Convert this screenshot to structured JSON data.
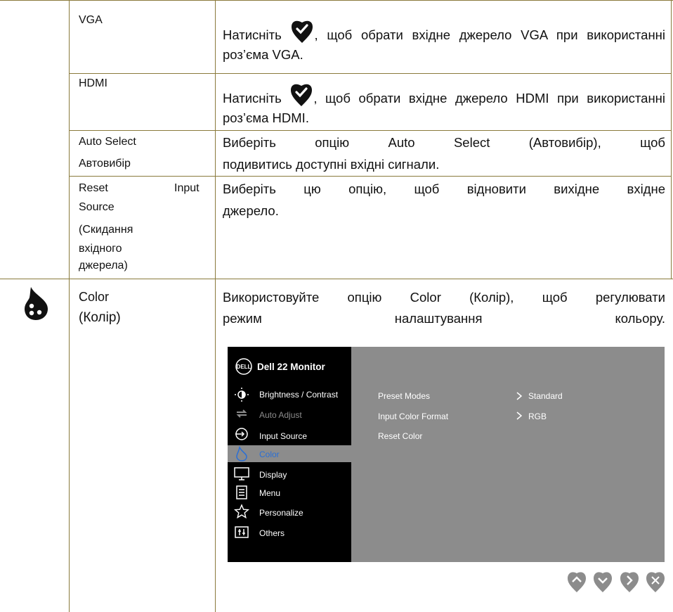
{
  "rows": {
    "vga": {
      "option": "VGA",
      "desc_before": "Натисніть",
      "desc_after": ", щоб обрати  вхідне джерело VGA при використанні роз’єма VGA."
    },
    "hdmi": {
      "option": "HDMI",
      "desc_before": "Натисніть",
      "desc_after": ", щоб обрати вхідне джерело HDMI  при використанні роз’єма HDMI."
    },
    "auto_select": {
      "option_en": "Auto Select",
      "option_uk": "Автовибір",
      "desc_line1": "Виберіть опцію Auto Select (Автовибір), щоб",
      "desc_line2": "подивитись доступні вхідні сигнали."
    },
    "reset_input": {
      "option_line1": "Reset",
      "option_line1b": "Input",
      "option_line2": "Source",
      "option_line3": "(Скидання",
      "option_line4": "вхідного",
      "option_line5": "джерела)",
      "desc_line1": "Виберіть цю опцію, щоб відновити вихідне вхідне",
      "desc_line2": "джерело."
    },
    "color": {
      "icon": "color-drop-icon",
      "option_en": "Color",
      "option_uk": "(Колір)",
      "desc_line1": "Використовуйте опцію Color (Колір), щоб регулювати",
      "desc_line2a": "режим",
      "desc_line2b": "налаштування",
      "desc_line2c": "кольору."
    }
  },
  "osd": {
    "brand": "DELL",
    "title": "Dell 22 Monitor",
    "menu": [
      {
        "label": "Brightness / Contrast",
        "icon": "brightness-icon"
      },
      {
        "label": "Auto Adjust",
        "icon": "auto-adjust-icon"
      },
      {
        "label": "Input Source",
        "icon": "input-source-icon"
      },
      {
        "label": "Color",
        "icon": "color-icon"
      },
      {
        "label": "Display",
        "icon": "display-icon"
      },
      {
        "label": "Menu",
        "icon": "menu-icon"
      },
      {
        "label": "Personalize",
        "icon": "star-icon"
      },
      {
        "label": "Others",
        "icon": "others-icon"
      }
    ],
    "settings": [
      {
        "label": "Preset Modes",
        "value": "Standard"
      },
      {
        "label": "Input Color Format",
        "value": "RGB"
      },
      {
        "label": "Reset Color",
        "value": ""
      }
    ],
    "colors": {
      "menu_bg": "#000000",
      "panel_bg": "#8c8c8c",
      "selected_text": "#2a6fd6"
    }
  },
  "nav_buttons": [
    "up-icon",
    "down-icon",
    "next-icon",
    "exit-icon"
  ]
}
